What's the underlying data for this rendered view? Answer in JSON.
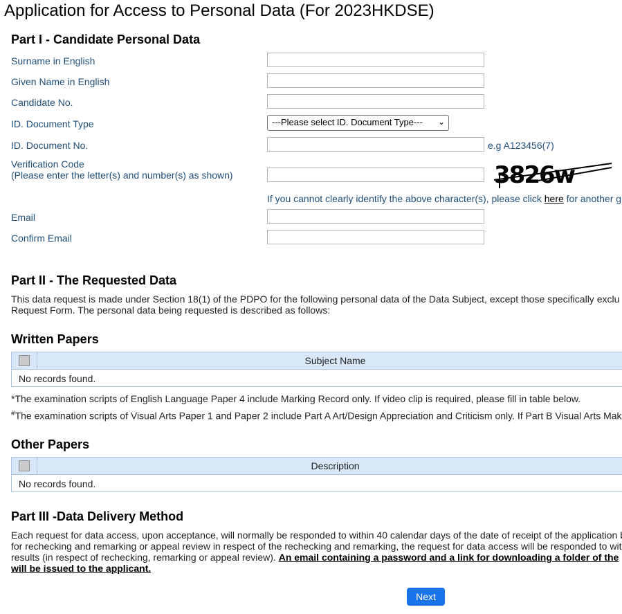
{
  "page": {
    "title": "Application for Access to Personal Data (For 2023HKDSE)"
  },
  "part1": {
    "heading": "Part I - Candidate Personal Data",
    "surname_label": "Surname in English",
    "given_name_label": "Given Name in English",
    "candidate_no_label": "Candidate No.",
    "id_doc_type_label": "ID. Document Type",
    "id_doc_type_value": "---Please select ID. Document Type---",
    "id_doc_no_label": "ID. Document No.",
    "id_doc_no_hint": "e.g A123456(7)",
    "verification_label": "Verification Code",
    "verification_sublabel": "(Please enter the letter(s) and number(s) as shown)",
    "captcha_text": "3826w",
    "captcha_help_pre": "If you cannot clearly identify the above character(s), please click ",
    "captcha_help_link": "here",
    "captcha_help_post": " for another g",
    "email_label": "Email",
    "confirm_email_label": "Confirm Email"
  },
  "part2": {
    "heading": "Part II - The Requested Data",
    "text_line1": "This data request is made under Section 18(1) of the PDPO for the following personal data of the Data Subject, except those specifically exclu",
    "text_line2": "Request Form. The personal data being requested is described as follows:"
  },
  "written_papers": {
    "heading": "Written Papers",
    "column": "Subject Name",
    "empty": "No records found.",
    "note1": "*The examination scripts of English Language Paper 4 include Marking Record only. If video clip is required, please fill in table below.",
    "note2_mark": "#",
    "note2": "The examination scripts of Visual Arts Paper 1 and Paper 2 include Part A Art/Design Appreciation and Criticism only. If Part B Visual Arts Mak"
  },
  "other_papers": {
    "heading": "Other Papers",
    "column": "Description",
    "empty": "No records found."
  },
  "part3": {
    "heading": "Part III -Data Delivery Method",
    "line1": "Each request for data access, upon acceptance, will normally be responded to within 40 calendar days of the date of receipt of the application b",
    "line2": "for rechecking and remarking or appeal review in respect of the rechecking and remarking, the request for data access will be responded to wit",
    "line3_pre": "results (in respect of rechecking, remarking or appeal review). ",
    "line3_bold": "An email containing a password and a link for downloading a folder of the",
    "line4_bold": "will be issued to the applicant."
  },
  "actions": {
    "next_label": "Next"
  }
}
